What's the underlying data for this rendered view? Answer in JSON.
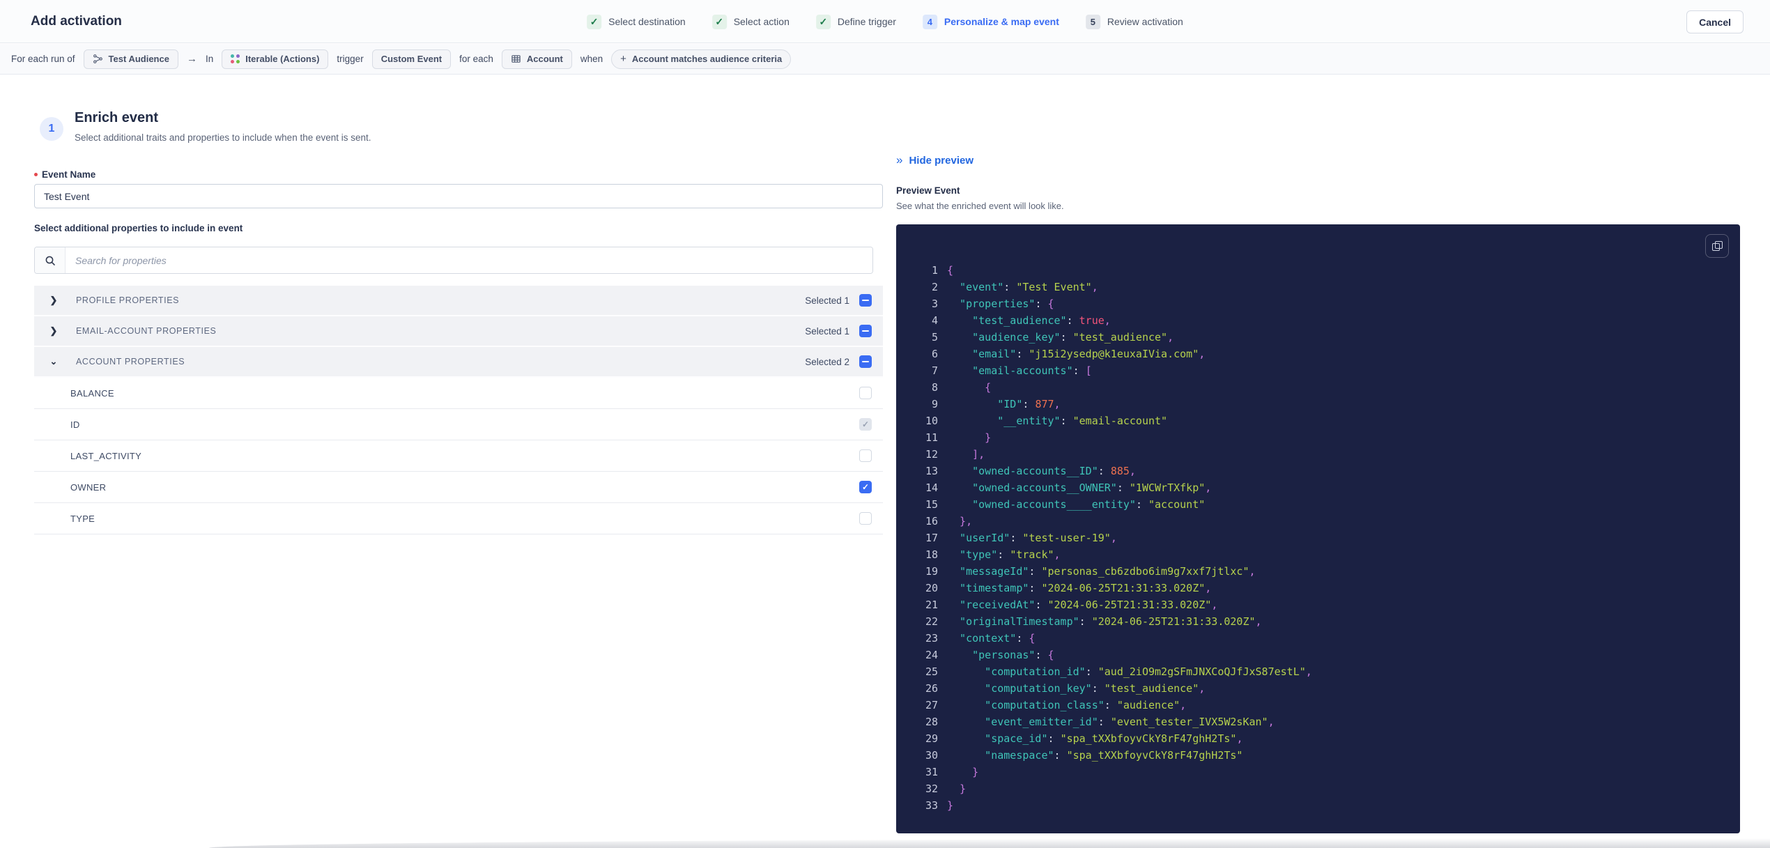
{
  "colors": {
    "accent": "#3a6cf3",
    "link": "#2166e0",
    "done_green": "#1c7c4b",
    "code_bg": "#1b2143",
    "code_key": "#3fc4b7",
    "code_string": "#b6d24d",
    "code_number": "#ed7150",
    "code_bool": "#f4547a",
    "code_punct": "#c678dd",
    "code_plain": "#d9dce8",
    "code_lineno": "#c7cbdc"
  },
  "header": {
    "title": "Add activation",
    "cancel_label": "Cancel",
    "steps": [
      {
        "state": "done",
        "badge": "check",
        "label": "Select destination"
      },
      {
        "state": "done",
        "badge": "check",
        "label": "Select action"
      },
      {
        "state": "done",
        "badge": "check",
        "label": "Define trigger"
      },
      {
        "state": "active",
        "badge": "4",
        "label": "Personalize & map event"
      },
      {
        "state": "todo",
        "badge": "5",
        "label": "Review activation"
      }
    ]
  },
  "trigger_bar": {
    "segments": [
      {
        "type": "text",
        "text": "For each run of"
      },
      {
        "type": "chip",
        "icon": "audience-icon",
        "label": "Test Audience"
      },
      {
        "type": "arrow",
        "text": "→"
      },
      {
        "type": "text",
        "text": "In"
      },
      {
        "type": "chip",
        "icon": "iterable-icon",
        "label": "Iterable (Actions)"
      },
      {
        "type": "text",
        "text": "trigger"
      },
      {
        "type": "chip",
        "label": "Custom Event"
      },
      {
        "type": "text",
        "text": "for each"
      },
      {
        "type": "chip",
        "icon": "table-icon",
        "label": "Account"
      },
      {
        "type": "text",
        "text": "when"
      },
      {
        "type": "chip",
        "icon": "plus-icon",
        "label": "Account matches audience criteria",
        "pill": true
      }
    ]
  },
  "enrich": {
    "step_number": "1",
    "title": "Enrich event",
    "subtitle": "Select additional traits and properties to include when the event is sent.",
    "event_name_label": "Event Name",
    "event_name_value": "Test Event",
    "properties_label": "Select additional properties to include in event",
    "search_placeholder": "Search for properties",
    "groups": [
      {
        "label": "PROFILE PROPERTIES",
        "selected_text": "Selected 1",
        "expanded": false,
        "checkbox": "indeterminate",
        "items": []
      },
      {
        "label": "EMAIL-ACCOUNT PROPERTIES",
        "selected_text": "Selected 1",
        "expanded": false,
        "checkbox": "indeterminate",
        "items": []
      },
      {
        "label": "ACCOUNT PROPERTIES",
        "selected_text": "Selected 2",
        "expanded": true,
        "checkbox": "indeterminate",
        "items": [
          {
            "label": "BALANCE",
            "checkbox": "unchecked"
          },
          {
            "label": "ID",
            "checkbox": "checked-disabled"
          },
          {
            "label": "LAST_ACTIVITY",
            "checkbox": "unchecked"
          },
          {
            "label": "OWNER",
            "checkbox": "checked"
          },
          {
            "label": "TYPE",
            "checkbox": "unchecked"
          }
        ]
      }
    ]
  },
  "preview": {
    "hide_label": "Hide preview",
    "title": "Preview Event",
    "subtitle": "See what the enriched event will look like.",
    "copy_icon": "copy-icon",
    "code": {
      "lines": [
        [
          [
            "p",
            "{"
          ]
        ],
        [
          [
            "k",
            "  \"event\""
          ],
          [
            "o",
            ": "
          ],
          [
            "s",
            "\"Test Event\""
          ],
          [
            "p",
            ","
          ]
        ],
        [
          [
            "k",
            "  \"properties\""
          ],
          [
            "o",
            ": "
          ],
          [
            "p",
            "{"
          ]
        ],
        [
          [
            "k",
            "    \"test_audience\""
          ],
          [
            "o",
            ": "
          ],
          [
            "b",
            "true"
          ],
          [
            "p",
            ","
          ]
        ],
        [
          [
            "k",
            "    \"audience_key\""
          ],
          [
            "o",
            ": "
          ],
          [
            "s",
            "\"test_audience\""
          ],
          [
            "p",
            ","
          ]
        ],
        [
          [
            "k",
            "    \"email\""
          ],
          [
            "o",
            ": "
          ],
          [
            "s",
            "\"j15i2ysedp@k1euxaIVia.com\""
          ],
          [
            "p",
            ","
          ]
        ],
        [
          [
            "k",
            "    \"email-accounts\""
          ],
          [
            "o",
            ": "
          ],
          [
            "p",
            "["
          ]
        ],
        [
          [
            "p",
            "      {"
          ]
        ],
        [
          [
            "k",
            "        \"ID\""
          ],
          [
            "o",
            ": "
          ],
          [
            "n",
            "877"
          ],
          [
            "p",
            ","
          ]
        ],
        [
          [
            "k",
            "        \"__entity\""
          ],
          [
            "o",
            ": "
          ],
          [
            "s",
            "\"email-account\""
          ]
        ],
        [
          [
            "p",
            "      }"
          ]
        ],
        [
          [
            "p",
            "    ],"
          ]
        ],
        [
          [
            "k",
            "    \"owned-accounts__ID\""
          ],
          [
            "o",
            ": "
          ],
          [
            "n",
            "885"
          ],
          [
            "p",
            ","
          ]
        ],
        [
          [
            "k",
            "    \"owned-accounts__OWNER\""
          ],
          [
            "o",
            ": "
          ],
          [
            "s",
            "\"1WCWrTXfkp\""
          ],
          [
            "p",
            ","
          ]
        ],
        [
          [
            "k",
            "    \"owned-accounts____entity\""
          ],
          [
            "o",
            ": "
          ],
          [
            "s",
            "\"account\""
          ]
        ],
        [
          [
            "p",
            "  },"
          ]
        ],
        [
          [
            "k",
            "  \"userId\""
          ],
          [
            "o",
            ": "
          ],
          [
            "s",
            "\"test-user-19\""
          ],
          [
            "p",
            ","
          ]
        ],
        [
          [
            "k",
            "  \"type\""
          ],
          [
            "o",
            ": "
          ],
          [
            "s",
            "\"track\""
          ],
          [
            "p",
            ","
          ]
        ],
        [
          [
            "k",
            "  \"messageId\""
          ],
          [
            "o",
            ": "
          ],
          [
            "s",
            "\"personas_cb6zdbo6im9g7xxf7jtlxc\""
          ],
          [
            "p",
            ","
          ]
        ],
        [
          [
            "k",
            "  \"timestamp\""
          ],
          [
            "o",
            ": "
          ],
          [
            "s",
            "\"2024-06-25T21:31:33.020Z\""
          ],
          [
            "p",
            ","
          ]
        ],
        [
          [
            "k",
            "  \"receivedAt\""
          ],
          [
            "o",
            ": "
          ],
          [
            "s",
            "\"2024-06-25T21:31:33.020Z\""
          ],
          [
            "p",
            ","
          ]
        ],
        [
          [
            "k",
            "  \"originalTimestamp\""
          ],
          [
            "o",
            ": "
          ],
          [
            "s",
            "\"2024-06-25T21:31:33.020Z\""
          ],
          [
            "p",
            ","
          ]
        ],
        [
          [
            "k",
            "  \"context\""
          ],
          [
            "o",
            ": "
          ],
          [
            "p",
            "{"
          ]
        ],
        [
          [
            "k",
            "    \"personas\""
          ],
          [
            "o",
            ": "
          ],
          [
            "p",
            "{"
          ]
        ],
        [
          [
            "k",
            "      \"computation_id\""
          ],
          [
            "o",
            ": "
          ],
          [
            "s",
            "\"aud_2iO9m2gSFmJNXCoQJfJxS87estL\""
          ],
          [
            "p",
            ","
          ]
        ],
        [
          [
            "k",
            "      \"computation_key\""
          ],
          [
            "o",
            ": "
          ],
          [
            "s",
            "\"test_audience\""
          ],
          [
            "p",
            ","
          ]
        ],
        [
          [
            "k",
            "      \"computation_class\""
          ],
          [
            "o",
            ": "
          ],
          [
            "s",
            "\"audience\""
          ],
          [
            "p",
            ","
          ]
        ],
        [
          [
            "k",
            "      \"event_emitter_id\""
          ],
          [
            "o",
            ": "
          ],
          [
            "s",
            "\"event_tester_IVX5W2sKan\""
          ],
          [
            "p",
            ","
          ]
        ],
        [
          [
            "k",
            "      \"space_id\""
          ],
          [
            "o",
            ": "
          ],
          [
            "s",
            "\"spa_tXXbfoyvCkY8rF47ghH2Ts\""
          ],
          [
            "p",
            ","
          ]
        ],
        [
          [
            "k",
            "      \"namespace\""
          ],
          [
            "o",
            ": "
          ],
          [
            "s",
            "\"spa_tXXbfoyvCkY8rF47ghH2Ts\""
          ]
        ],
        [
          [
            "p",
            "    }"
          ]
        ],
        [
          [
            "p",
            "  }"
          ]
        ],
        [
          [
            "p",
            "}"
          ]
        ]
      ]
    }
  }
}
